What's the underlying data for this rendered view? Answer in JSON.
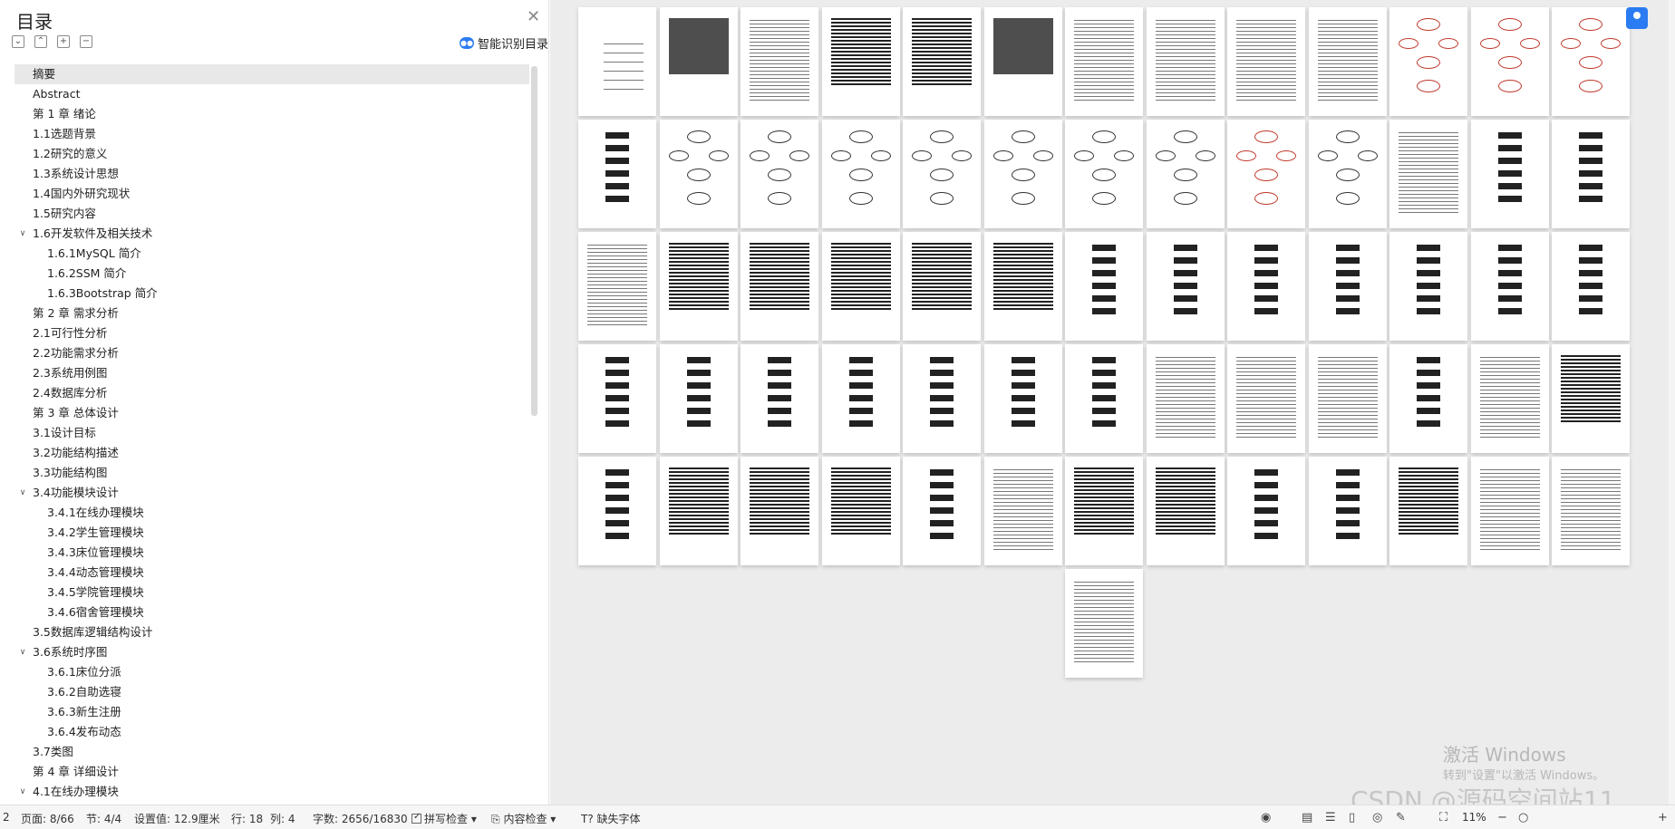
{
  "toc": {
    "title": "目录",
    "smart_toc_label": "智能识别目录",
    "items": [
      {
        "label": "摘要",
        "level": 1,
        "selected": true
      },
      {
        "label": "Abstract",
        "level": 1
      },
      {
        "label": "第 1 章  绪论",
        "level": 1
      },
      {
        "label": "1.1选题背景",
        "level": 1
      },
      {
        "label": "1.2研究的意义",
        "level": 1
      },
      {
        "label": "1.3系统设计思想",
        "level": 1
      },
      {
        "label": "1.4国内外研究现状",
        "level": 1
      },
      {
        "label": "1.5研究内容",
        "level": 1
      },
      {
        "label": "1.6开发软件及相关技术",
        "level": 1,
        "expanded": true
      },
      {
        "label": "1.6.1MySQL 简介",
        "level": 2
      },
      {
        "label": "1.6.2SSM 简介",
        "level": 2
      },
      {
        "label": "1.6.3Bootstrap 简介",
        "level": 2
      },
      {
        "label": "第 2 章  需求分析",
        "level": 1
      },
      {
        "label": "2.1可行性分析",
        "level": 1
      },
      {
        "label": "2.2功能需求分析",
        "level": 1
      },
      {
        "label": "2.3系统用例图",
        "level": 1
      },
      {
        "label": "2.4数据库分析",
        "level": 1
      },
      {
        "label": "第 3 章  总体设计",
        "level": 1
      },
      {
        "label": "3.1设计目标",
        "level": 1
      },
      {
        "label": "3.2功能结构描述",
        "level": 1
      },
      {
        "label": "3.3功能结构图",
        "level": 1
      },
      {
        "label": "3.4功能模块设计",
        "level": 1,
        "expanded": true
      },
      {
        "label": "3.4.1在线办理模块",
        "level": 2
      },
      {
        "label": "3.4.2学生管理模块",
        "level": 2
      },
      {
        "label": "3.4.3床位管理模块",
        "level": 2
      },
      {
        "label": "3.4.4动态管理模块",
        "level": 2
      },
      {
        "label": "3.4.5学院管理模块",
        "level": 2
      },
      {
        "label": "3.4.6宿舍管理模块",
        "level": 2
      },
      {
        "label": "3.5数据库逻辑结构设计",
        "level": 1
      },
      {
        "label": "3.6系统时序图",
        "level": 1,
        "expanded": true
      },
      {
        "label": "3.6.1床位分派",
        "level": 2
      },
      {
        "label": "3.6.2自助选寝",
        "level": 2
      },
      {
        "label": "3.6.3新生注册",
        "level": 2
      },
      {
        "label": "3.6.4发布动态",
        "level": 2
      },
      {
        "label": "3.7类图",
        "level": 1
      },
      {
        "label": "第 4 章  详细设计",
        "level": 1
      },
      {
        "label": "4.1在线办理模块",
        "level": 1,
        "expanded": true
      }
    ]
  },
  "status_bar": {
    "page_index": "2",
    "page": "页面: 8/66",
    "section": "节: 4/4",
    "setting": "设置值: 12.9厘米",
    "row": "行: 18",
    "col": "列: 4",
    "word_count": "字数: 2656/16830",
    "spell_check": "拼写检查",
    "content_check": "内容检查",
    "missing_font": "缺失字体",
    "zoom": "11%"
  },
  "watermark": {
    "activate_title": "激活 Windows",
    "activate_sub": "转到\"设置\"以激活 Windows。",
    "csdn": "CSDN @源码空间站11"
  },
  "colors": {
    "accent": "#2b7bf2",
    "selected_bg": "#e8e8e8",
    "doc_bg": "#ececec"
  }
}
